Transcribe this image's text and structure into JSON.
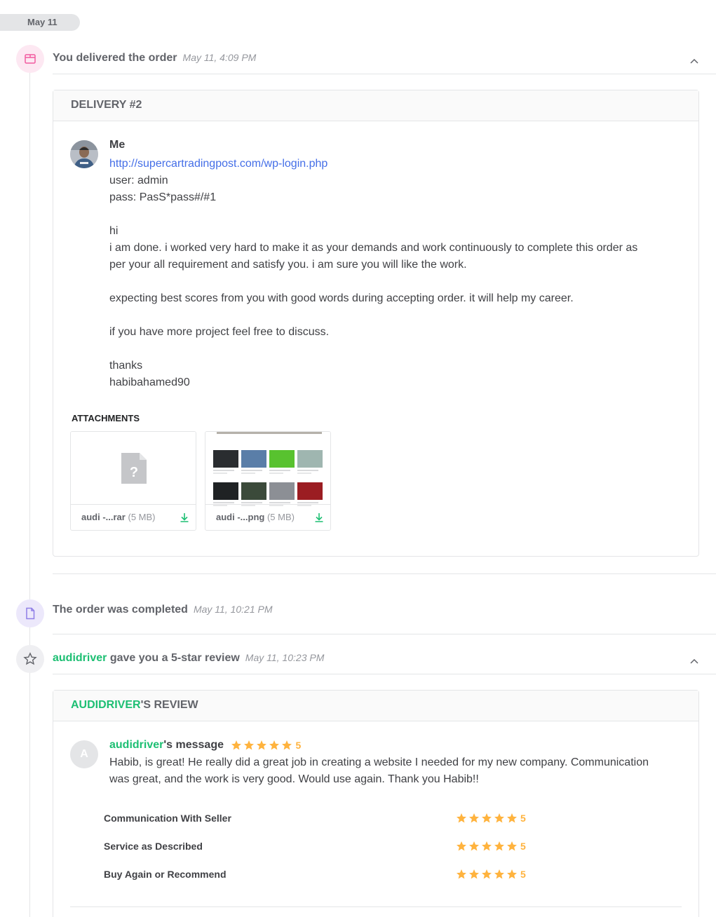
{
  "date_pill": "May 11",
  "events": {
    "delivered": {
      "title": "You delivered the order",
      "time": "May 11, 4:09 PM",
      "icon": "package-icon",
      "color": "#f25ba0"
    },
    "completed": {
      "title": "The order was completed",
      "time": "May 11, 10:21 PM",
      "icon": "document-icon",
      "color": "#8f7ee7"
    },
    "review": {
      "user": "audidriver",
      "title": "gave you a 5-star review",
      "time": "May 11, 10:23 PM",
      "icon": "star-outline-icon"
    }
  },
  "delivery": {
    "header": "DELIVERY #2",
    "sender": "Me",
    "link": "http://supercartradingpost.com/wp-login.php",
    "lines": [
      "user: admin",
      "pass: PasS*pass#/#1",
      "",
      "hi",
      "i am done. i worked very hard to make it as your demands and work continuously to complete this order as per your all requirement and satisfy you. i am sure you will like the work.",
      "",
      "expecting best scores from you with good words during accepting order. it will help my career.",
      "",
      "if you have more project feel free to discuss.",
      "",
      "thanks",
      "habibahamed90"
    ],
    "attachments_label": "ATTACHMENTS",
    "attachments": [
      {
        "name": "audi -...rar",
        "size": "(5 MB)"
      },
      {
        "name": "audi -...png",
        "size": "(5 MB)"
      }
    ]
  },
  "review": {
    "header_user": "AUDIDRIVER",
    "header_suffix": "'S REVIEW",
    "avatar_letter": "A",
    "message_user": "audidriver",
    "message_suffix": "'s message",
    "score": "5",
    "text": "Habib, is great! He really did a great job in creating a website I needed for my new company. Communication was great, and the work is very good. Would use again. Thank you Habib!!",
    "ratings": [
      {
        "label": "Communication With Seller",
        "score": "5"
      },
      {
        "label": "Service as Described",
        "score": "5"
      },
      {
        "label": "Buy Again or Recommend",
        "score": "5"
      }
    ]
  },
  "colors": {
    "accent_green": "#1dbf73",
    "link_blue": "#446ee7",
    "star_gold": "#ffb33e"
  }
}
